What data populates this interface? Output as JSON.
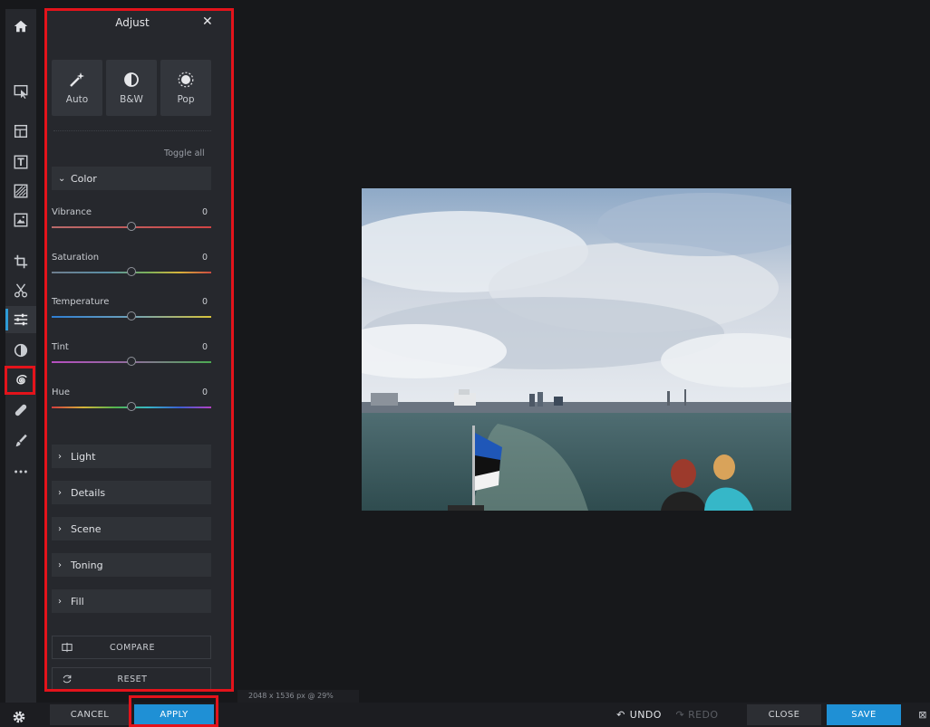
{
  "panel": {
    "title": "Adjust",
    "close_icon": "close-icon",
    "presets": [
      {
        "label": "Auto",
        "icon": "magic-wand-icon"
      },
      {
        "label": "B&W",
        "icon": "half-circle-icon"
      },
      {
        "label": "Pop",
        "icon": "sun-icon"
      }
    ],
    "toggle_all": "Toggle all",
    "color_section": "Color",
    "sliders": [
      {
        "name": "Vibrance",
        "value": "0"
      },
      {
        "name": "Saturation",
        "value": "0"
      },
      {
        "name": "Temperature",
        "value": "0"
      },
      {
        "name": "Tint",
        "value": "0"
      },
      {
        "name": "Hue",
        "value": "0"
      }
    ],
    "collapsed_sections": [
      "Light",
      "Details",
      "Scene",
      "Toning",
      "Fill"
    ],
    "compare_label": "COMPARE",
    "reset_label": "RESET"
  },
  "canvas": {
    "image_info": "2048 x 1536 px @ 29%"
  },
  "bottom_bar": {
    "cancel": "CANCEL",
    "apply": "APPLY",
    "undo": "UNDO",
    "redo": "REDO",
    "close": "CLOSE",
    "save": "SAVE"
  },
  "toolbar_icons": [
    "home-icon",
    "select-icon",
    "layout-icon",
    "text-icon",
    "texture-icon",
    "image-icon",
    "crop-icon",
    "cut-icon",
    "adjust-icon",
    "filter-icon",
    "spiral-icon",
    "bandage-icon",
    "brush-icon",
    "more-icon",
    "settings-icon"
  ],
  "colors": {
    "accent": "#1f90d5",
    "highlight": "#e3131b",
    "panel": "#26282d",
    "background": "#17181b"
  }
}
